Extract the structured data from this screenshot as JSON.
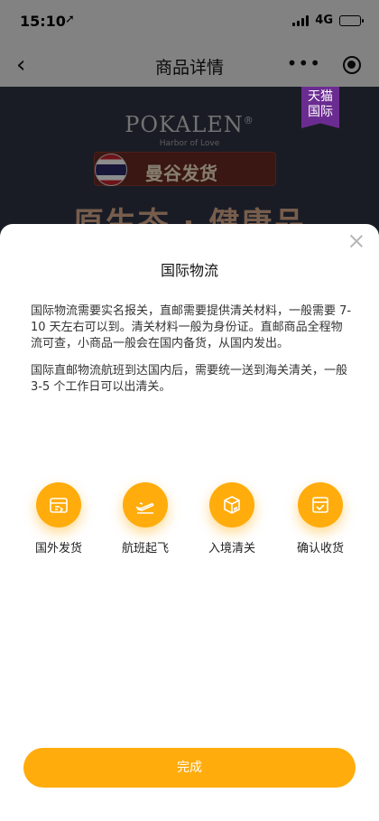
{
  "status": {
    "time": "15:10",
    "location_icon": "location-arrow-icon",
    "network": "4G"
  },
  "nav": {
    "back_icon": "‹",
    "title": "商品详情",
    "more_icon": "•••"
  },
  "banner": {
    "brand": "POKALEN",
    "brand_mark": "®",
    "brand_sub": "Harbor of Love",
    "pill_text": "曼谷发货",
    "headline": "原生态 · 健康品",
    "badge": [
      "天猫",
      "国际"
    ]
  },
  "sheet": {
    "title": "国际物流",
    "para1": "国际物流需要实名报关，直邮需要提供清关材料，一般需要 7-10 天左右可以到。清关材料一般为身份证。直邮商品全程物流可查，小商品一般会在国内备货，从国内发出。",
    "para2": "国际直邮物流航班到达国内后，需要统一送到海关清关，一般 3-5 个工作日可以出清关。",
    "steps": [
      {
        "label": "国外发货",
        "icon": "shipping-box-icon"
      },
      {
        "label": "航班起飞",
        "icon": "airplane-takeoff-icon"
      },
      {
        "label": "入境清关",
        "icon": "customs-box-icon"
      },
      {
        "label": "确认收货",
        "icon": "receive-box-icon"
      }
    ],
    "done_label": "完成"
  },
  "colors": {
    "accent": "#ffac0c",
    "banner_bg": "#2f3444",
    "tmall_purple": "#6b2c91"
  }
}
